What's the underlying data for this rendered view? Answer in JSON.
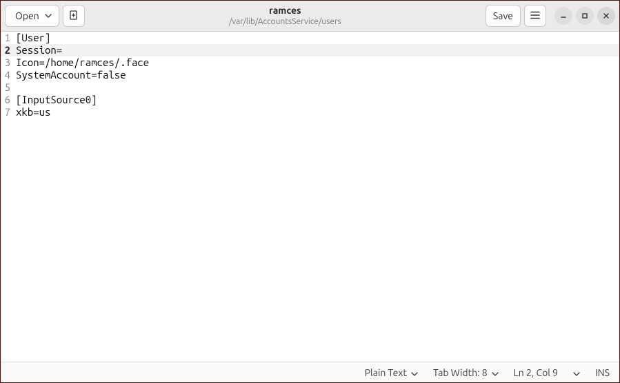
{
  "header": {
    "open_label": "Open",
    "save_label": "Save",
    "title": "ramces",
    "subtitle": "/var/lib/AccountsService/users"
  },
  "editor": {
    "lines": [
      "[User]",
      "Session=",
      "Icon=/home/ramces/.face",
      "SystemAccount=false",
      "",
      "[InputSource0]",
      "xkb=us"
    ],
    "highlighted_line_index": 1
  },
  "statusbar": {
    "language": "Plain Text",
    "tab_width": "Tab Width: 8",
    "position": "Ln 2, Col 9",
    "insert_mode": "INS"
  }
}
